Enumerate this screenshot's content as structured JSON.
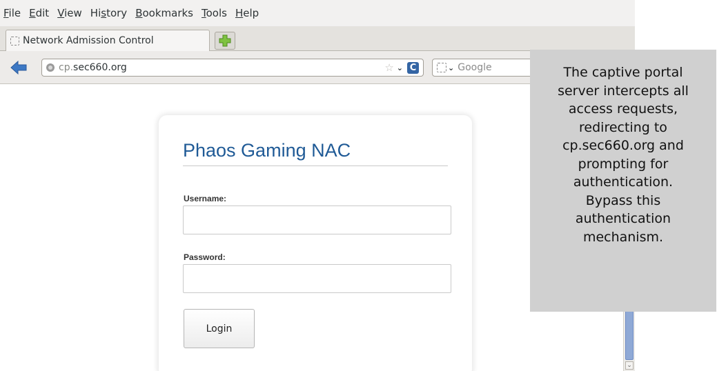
{
  "menubar": {
    "items": [
      {
        "pre": "",
        "accel": "F",
        "post": "ile"
      },
      {
        "pre": "",
        "accel": "E",
        "post": "dit"
      },
      {
        "pre": "",
        "accel": "V",
        "post": "iew"
      },
      {
        "pre": "Hi",
        "accel": "s",
        "post": "tory"
      },
      {
        "pre": "",
        "accel": "B",
        "post": "ookmarks"
      },
      {
        "pre": "",
        "accel": "T",
        "post": "ools"
      },
      {
        "pre": "",
        "accel": "H",
        "post": "elp"
      }
    ]
  },
  "tabs": {
    "active_title": "Network Admission Control",
    "new_tab_symbol": "+"
  },
  "navbar": {
    "url_prefix": "cp.",
    "url_main": "sec660.org",
    "star_symbol": "☆",
    "chevron_symbol": "⌄",
    "reload_symbol": "C",
    "search_placeholder": "Google",
    "search_chevron": "⌄"
  },
  "login": {
    "title": "Phaos Gaming NAC",
    "username_label": "Username:",
    "username_value": "",
    "password_label": "Password:",
    "password_value": "",
    "button_label": "Login"
  },
  "scrollbar": {
    "down_symbol": "⌄"
  },
  "annotation": {
    "lines": [
      "The captive portal",
      "server intercepts all",
      "access requests,",
      "redirecting to",
      "cp.sec660.org and",
      "prompting for",
      "authentication.",
      "Bypass this",
      "authentication",
      "mechanism."
    ]
  },
  "colors": {
    "title_blue": "#1f5a96",
    "annotation_bg": "#d0d0d0",
    "scroll_thumb": "#8fa9d6"
  },
  "icons": {
    "back": "back-arrow-icon",
    "globe": "globe-icon",
    "star": "star-icon",
    "reload": "reload-icon",
    "new_tab": "plus-icon"
  }
}
